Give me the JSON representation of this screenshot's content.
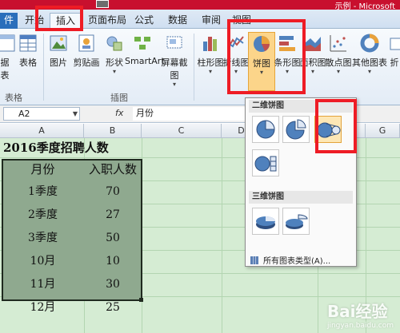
{
  "window": {
    "title": "示例 - Microsoft"
  },
  "tabs": [
    {
      "id": "file",
      "label": "件"
    },
    {
      "id": "home",
      "label": "开始"
    },
    {
      "id": "insert",
      "label": "插入"
    },
    {
      "id": "layout",
      "label": "页面布局"
    },
    {
      "id": "formula",
      "label": "公式"
    },
    {
      "id": "data",
      "label": "数据"
    },
    {
      "id": "review",
      "label": "审阅"
    },
    {
      "id": "view",
      "label": "视图"
    }
  ],
  "ribbon": {
    "buttons": {
      "pivot": "据",
      "pivot_sub": "表",
      "table": "表格",
      "picture": "图片",
      "clipart": "剪贴画",
      "shapes": "形状",
      "smartart": "SmartArt",
      "screenshot": "屏幕截图",
      "column": "柱形图",
      "line": "折线图",
      "pie": "饼图",
      "bar": "条形图",
      "area": "面积图",
      "scatter": "散点图",
      "other": "其他图表",
      "expand": "折"
    },
    "groups": {
      "tables": "表格",
      "illustrations": "插图"
    }
  },
  "formula_bar": {
    "name_box": "A2",
    "fx": "fx",
    "content": "月份"
  },
  "sheet": {
    "columns": [
      "A",
      "B",
      "C",
      "D",
      "E",
      "F",
      "G"
    ],
    "title": "2016季度招聘人数",
    "headers": [
      "月份",
      "入职人数"
    ],
    "rows": [
      {
        "label": "1季度",
        "value": "70"
      },
      {
        "label": "2季度",
        "value": "27"
      },
      {
        "label": "3季度",
        "value": "50"
      },
      {
        "label": "10月",
        "value": "10"
      },
      {
        "label": "11月",
        "value": "30"
      },
      {
        "label": "12月",
        "value": "25"
      }
    ]
  },
  "dropdown": {
    "section_2d": "二维饼图",
    "section_3d": "三维饼图",
    "all_types": "所有图表类型(A)..."
  },
  "watermark": {
    "brand": "Bai经验",
    "url": "jingyan.baidu.com"
  },
  "colors": {
    "annotation": "#ee1c25",
    "sheet_bg": "#d5ecd3",
    "selection": "#8aa58a"
  }
}
